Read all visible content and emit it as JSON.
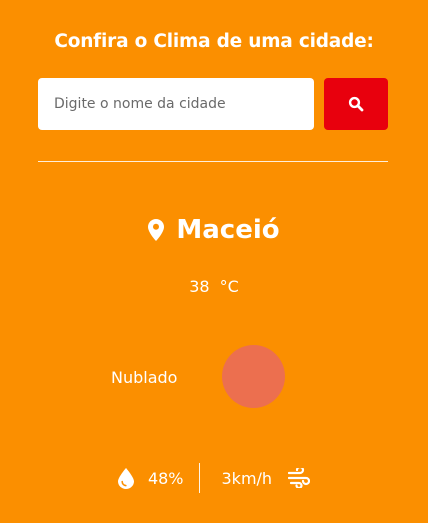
{
  "header": {
    "title": "Confira o Clima de uma cidade:"
  },
  "search": {
    "placeholder": "Digite o nome da cidade",
    "button_icon": "search-icon"
  },
  "weather": {
    "city": "Maceió",
    "location_icon": "map-pin-icon",
    "temperature": "38",
    "unit": "°C",
    "description": "Nublado",
    "icon": "cloud-icon",
    "icon_color": "#ec6f4f",
    "humidity": "48%",
    "humidity_icon": "water-drop-icon",
    "wind": "3km/h",
    "wind_icon": "wind-icon"
  },
  "colors": {
    "background": "#fb8f00",
    "search_button": "#e8000d",
    "text": "#ffffff"
  }
}
